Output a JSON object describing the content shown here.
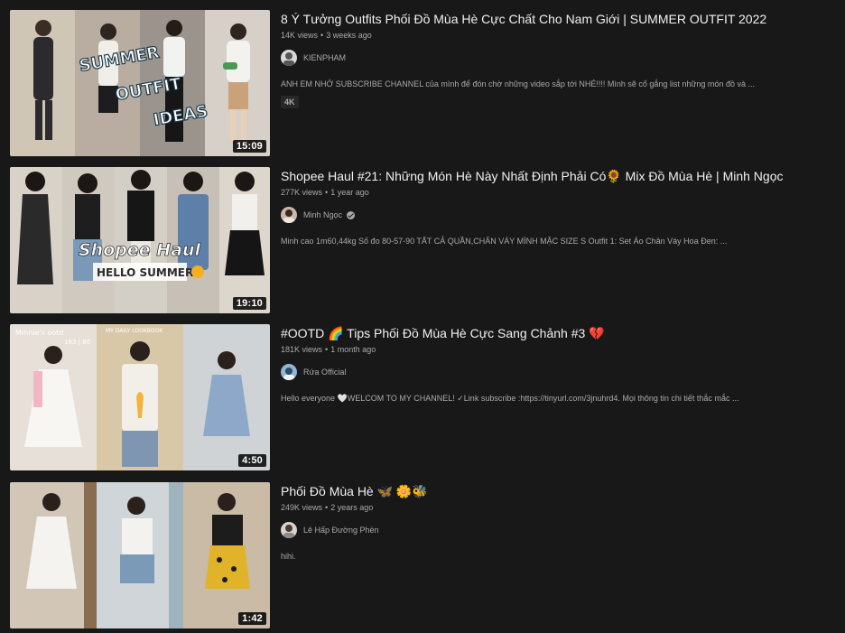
{
  "videos": [
    {
      "title": "8 Ý Tưởng Outfits Phối Đồ Mùa Hè Cực Chất Cho Nam Giới | SUMMER OUTFIT 2022",
      "views": "14K views",
      "age": "3 weeks ago",
      "channel": "KIENPHAM",
      "verified": false,
      "description": "ANH EM NHỚ SUBSCRIBE CHANNEL của mình để đón chờ những video sắp tới NHÉ!!!! Mình sẽ cố gắng list những món đồ và ...",
      "badge": "4K",
      "duration": "15:09",
      "thumb_text": [
        "SUMMER",
        "OUTFIT",
        "IDEAS"
      ]
    },
    {
      "title": "Shopee Haul #21: Những Món Hè Này Nhất Định Phải Có🌻 Mix Đồ Mùa Hè | Minh Ngọc",
      "views": "277K views",
      "age": "1 year ago",
      "channel": "Minh Ngọc",
      "verified": true,
      "description": "Minh cao 1m60,44kg Số đo 80-57-90 TẤT CẢ QUẦN,CHÂN VÁY MÌNH MẶC SIZE S Outfit 1: Set Áo Chân Váy Hoa Đen: ...",
      "duration": "19:10",
      "thumb_text": [
        "Shopee Haul",
        "HELLO SUMMER"
      ]
    },
    {
      "title": "#OOTD 🌈 Tips Phối Đồ Mùa Hè Cực Sang Chảnh #3 💔",
      "views": "181K views",
      "age": "1 month ago",
      "channel": "Rứa Official",
      "verified": false,
      "description": "Hello everyone 🤍WELCOM TO MY CHANNEL! ✓Link subscribe :https://tinyurl.com/3jnuhrd4. Mọi thông tin chi tiết thắc mắc ...",
      "duration": "4:50",
      "thumb_text": [
        "Minnie's ootd",
        "163 | 80",
        "MY DAILY LOOKBOOK"
      ]
    },
    {
      "title": "Phối Đồ Mùa Hè 🦋 🌼🐝",
      "views": "249K views",
      "age": "2 years ago",
      "channel": "Lê Hấp Đường Phèn",
      "verified": false,
      "description": "hihi.",
      "duration": "1:42"
    }
  ]
}
